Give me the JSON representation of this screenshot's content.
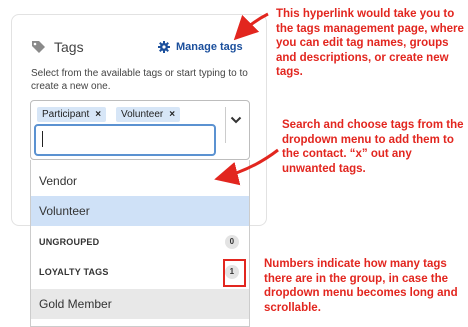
{
  "panel": {
    "title": "Tags",
    "manage_link": "Manage tags",
    "helper_text": "Select from the available tags or start typing to to create a new one.",
    "selected_tags": [
      {
        "label": "Participant",
        "remove": "×"
      },
      {
        "label": "Volunteer",
        "remove": "×"
      }
    ],
    "search_value": ""
  },
  "dropdown": {
    "options": [
      {
        "label": "Vendor"
      },
      {
        "label": "Volunteer"
      }
    ],
    "groups": [
      {
        "label": "UNGROUPED",
        "count": "0"
      },
      {
        "label": "LOYALTY TAGS",
        "count": "1"
      }
    ],
    "group_option": "Gold Member"
  },
  "annotations": [
    "This hyperlink would take you to the tags management page, where you can edit tag names, groups and descriptions, or create new tags.",
    "Search and choose tags from the dropdown menu to add them to the contact. “x” out any unwanted tags.",
    "Numbers indicate how many tags there are in the group, in case the dropdown menu becomes long and scrollable."
  ],
  "colors": {
    "annotation": "#e2261f",
    "link": "#1b4f9c",
    "chip": "#d7e6f7",
    "highlight": "#cfe1f7",
    "focus_border": "#5b92d1"
  },
  "icons": {
    "tag": "tag-icon",
    "gear": "gear-icon",
    "chevron": "chevron-down-icon"
  }
}
